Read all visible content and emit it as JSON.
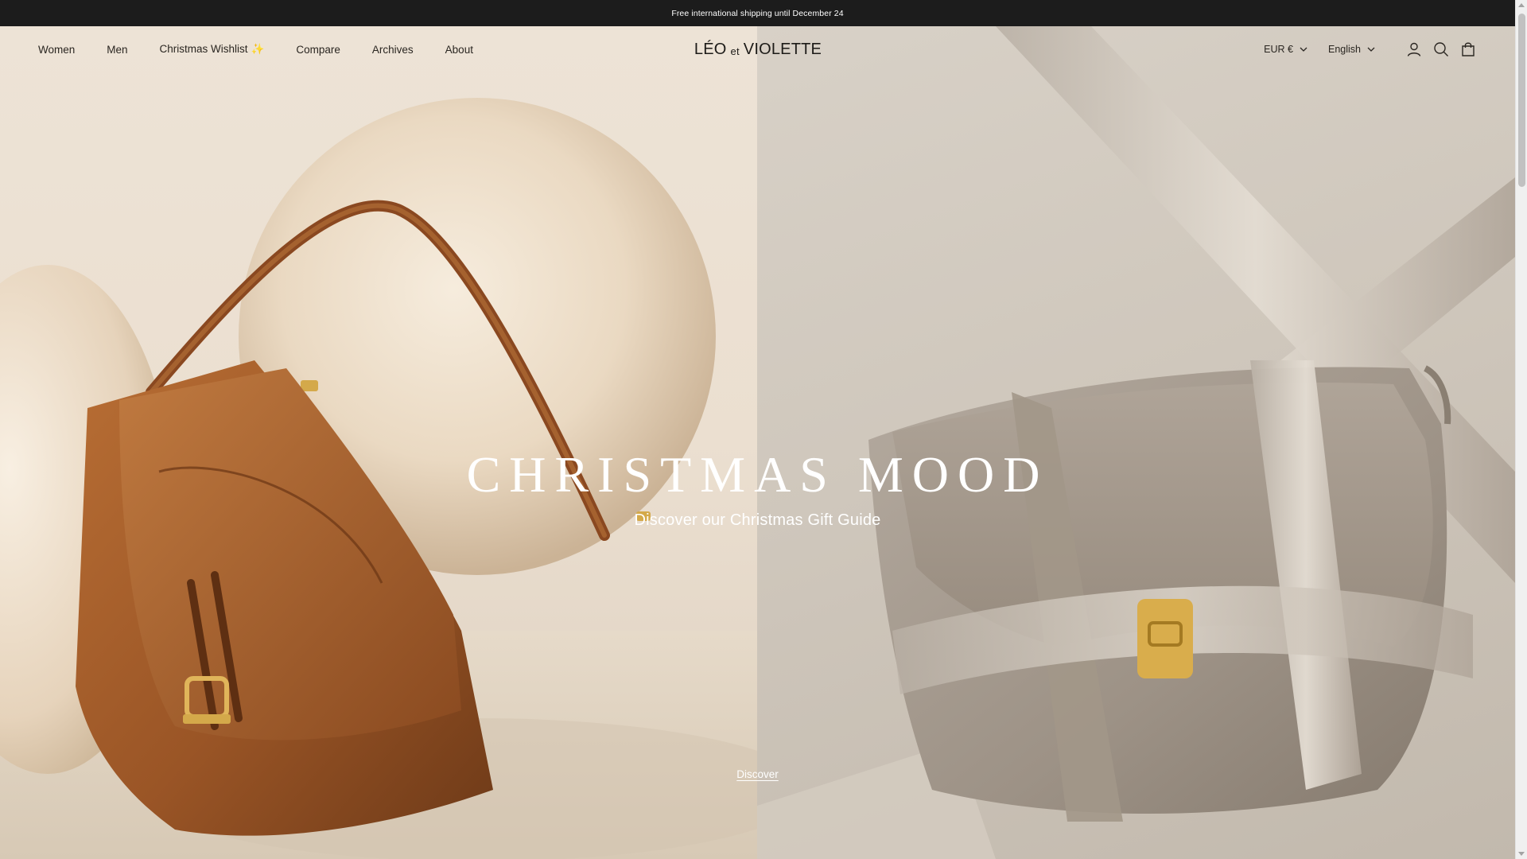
{
  "announcement": {
    "text": "Free international shipping until December 24"
  },
  "nav": {
    "items": [
      {
        "label": "Women"
      },
      {
        "label": "Men"
      },
      {
        "label": "Christmas Wishlist",
        "emoji": "✨"
      },
      {
        "label": "Compare"
      },
      {
        "label": "Archives"
      },
      {
        "label": "About"
      }
    ]
  },
  "logo": {
    "part1": "LÉO",
    "part2": "et",
    "part3": "VIOLETTE"
  },
  "selectors": {
    "currency": "EUR €",
    "language": "English"
  },
  "icons": {
    "account": "account-icon",
    "search": "search-icon",
    "cart": "cart-icon",
    "chevron": "chevron-down-icon"
  },
  "hero": {
    "title": "CHRISTMAS MOOD",
    "subtitle": "Discover our Christmas Gift Guide",
    "cta": "Discover"
  },
  "colors": {
    "announcement_bg": "#1c1c1c",
    "text_dark": "#2a2621",
    "hero_text": "#ffffff",
    "left_bg": "#ebdfd0",
    "right_bg": "#cfc7bc",
    "tan_leather": "#9a5a2a",
    "grey_leather": "#a79c90",
    "gold": "#d4a94a"
  }
}
